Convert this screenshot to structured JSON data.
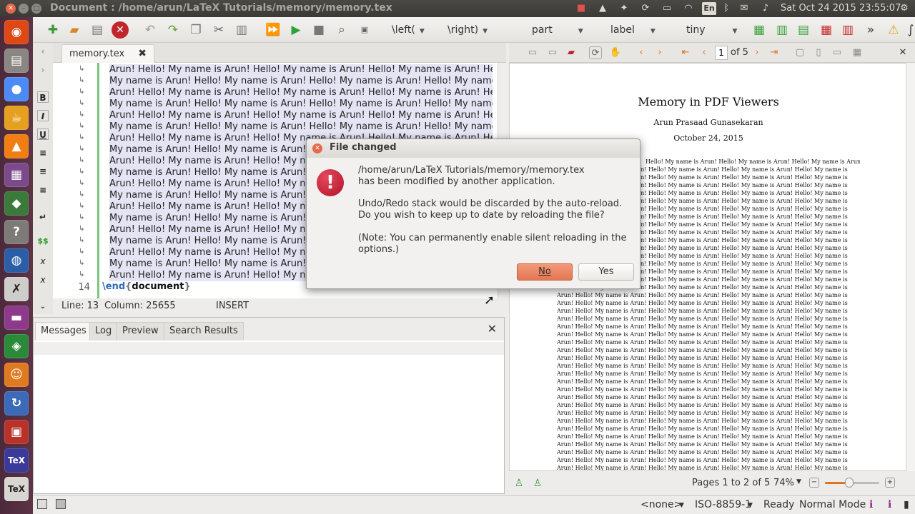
{
  "topbar": {
    "window_title": "Document : /home/arun/LaTeX Tutorials/memory/memory.tex",
    "keyboard": "En",
    "datetime": "Sat Oct 24 2015 23:55:07"
  },
  "toolbar": {
    "left_dropdown": "\\left(",
    "right_dropdown": "\\right)",
    "structure_dropdown": "part",
    "ref_dropdown": "label",
    "size_dropdown": "tiny"
  },
  "sidebar_symbols": [
    "B",
    "I",
    "U",
    "$$"
  ],
  "editor": {
    "tab_label": "memory.tex",
    "lines": [
      "Arun!   Hello! My name is Arun! Hello! My name is Arun! Hello! My name is Arun! Hello!",
      "My name is Arun!   Hello! My name is Arun! Hello! My name is Arun! Hello! My name is",
      "Arun!   Hello! My name is Arun! Hello! My name is Arun! Hello! My name is Arun! Hello!",
      "My name is Arun!   Hello! My name is Arun! Hello! My name is Arun! Hello! My name is",
      "Arun!   Hello! My name is Arun! Hello! My name is Arun! Hello! My name is Arun! Hello!",
      "My name is Arun!   Hello! My name is Arun! Hello! My name is Arun! Hello! My name is",
      "Arun!   Hello! My name is Arun! Hello! My name is Arun! Hello! My name is Arun! Hello!",
      "My name is Arun!   Hello! My name is Arun! Hello! My name is Arun! Hello! My name is",
      "Arun!   Hello! My name is Arun! Hello! My name is Arun! Hello! My name is Arun! Hello!",
      "My name is Arun!   Hello! My name is Arun! Hello! My name is Arun! Hello! My name is",
      "Arun!   Hello! My name is Arun! Hello! My name is Arun! Hello! My name is Arun! Hello!",
      "My name is Arun!   Hello! My name is Arun! Hello! My name is Arun! Hello! My name is",
      "Arun!   Hello! My name is Arun! Hello! My name is Arun! Hello! My name is Arun! Hello!",
      "My name is Arun!   Hello! My name is Arun!",
      "Arun!   Hello! My name is Arun! Hello! My name is Arun! Hello! My name is Arun! Hello!",
      "My name is Arun!   Hello! My name is Arun! Hello! My name is Arun! Hello! My name is",
      "Arun!   Hello! My name is Arun! Hello! My name is Arun! Hello! My name is Arun! Hello!",
      "My name is Arun!   Hello! My name is Arun! Hello! My name is Arun! Hello! My name is",
      "Arun!   Hello! My name is Arun! Hello! My name is Arun! Hello! My name is Arun! Hello!"
    ],
    "last_line_number": "14",
    "end_cmd": "\\end",
    "end_brace_open": "{",
    "end_env": "document",
    "end_brace_close": "}"
  },
  "status": {
    "line": "Line: 13",
    "column": "Column: 25655",
    "mode": "INSERT"
  },
  "messages": {
    "tabs": [
      "Messages",
      "Log",
      "Preview",
      "Search Results"
    ]
  },
  "pdf": {
    "page_input": "1",
    "page_of": "of 5",
    "title": "Memory in PDF Viewers",
    "author": "Arun Prasaad Gunasekaran",
    "date": "October 24, 2015",
    "body_line_a": "Hello!  My name is Arun!  Hello!  My name is Arun!  Hello!  My name is Arun!  Hello!  My name is",
    "body_line_b": "Arun!  Hello!  My name is Arun!  Hello!  My name is Arun!  Hello!  My name is Arun!  Hello!  My name is",
    "pages_status": "Pages 1 to 2 of 5",
    "zoom": "74%"
  },
  "bottom": {
    "bib": "<none>",
    "encoding": "ISO-8859-1",
    "ready": "Ready",
    "view_mode": "Normal Mode"
  },
  "dialog": {
    "title": "File changed",
    "line1": "/home/arun/LaTeX Tutorials/memory/memory.tex",
    "line2": "has been modified by another application.",
    "line3": "Undo/Redo stack would be discarded by the auto-reload.",
    "line4": "Do you wish to keep up to date by reloading the file?",
    "line5": "(Note: You can permanently enable silent reloading in the",
    "line6": "options.)",
    "no_label": "No",
    "yes_label": "Yes"
  }
}
